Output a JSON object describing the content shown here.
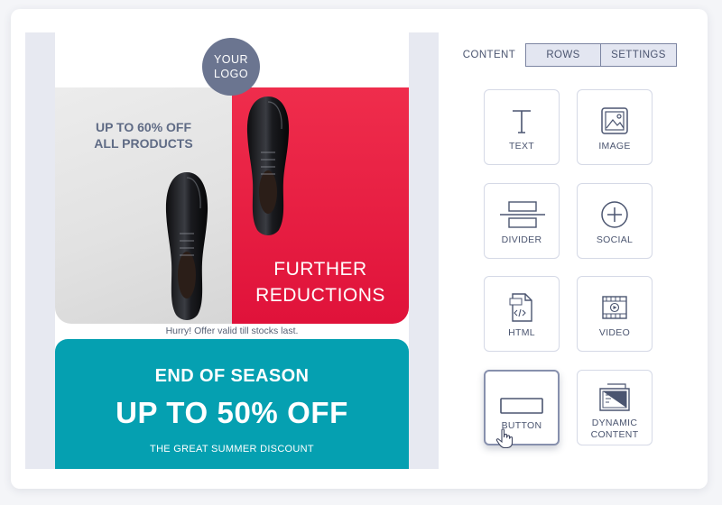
{
  "email": {
    "logo": {
      "line1": "YOUR",
      "line2": "LOGO"
    },
    "hero": {
      "left_line1": "UP TO 60% OFF",
      "left_line2": "ALL PRODUCTS",
      "right_line1": "FURTHER",
      "right_line2": "REDUCTIONS"
    },
    "note": "Hurry! Offer valid till stocks last.",
    "promo": {
      "line1": "END OF SEASON",
      "line2": "UP TO 50% OFF",
      "line3": "THE GREAT SUMMER DISCOUNT"
    }
  },
  "panel": {
    "tabs": {
      "content": "CONTENT",
      "rows": "ROWS",
      "settings": "SETTINGS"
    },
    "tiles": {
      "text": "TEXT",
      "image": "IMAGE",
      "divider": "DIVIDER",
      "social": "SOCIAL",
      "html": "HTML",
      "video": "VIDEO",
      "button": "BUTTON",
      "dynamic_line1": "DYNAMIC",
      "dynamic_line2": "CONTENT"
    }
  },
  "colors": {
    "accent_teal": "#05a0b1",
    "accent_red": "#e0123a",
    "logo_grey": "#6b7590",
    "ui_text": "#4b5570"
  },
  "icons": [
    "text-icon",
    "image-icon",
    "divider-icon",
    "social-icon",
    "html-icon",
    "video-icon",
    "button-icon",
    "dynamic-content-icon",
    "hand-cursor-icon"
  ]
}
